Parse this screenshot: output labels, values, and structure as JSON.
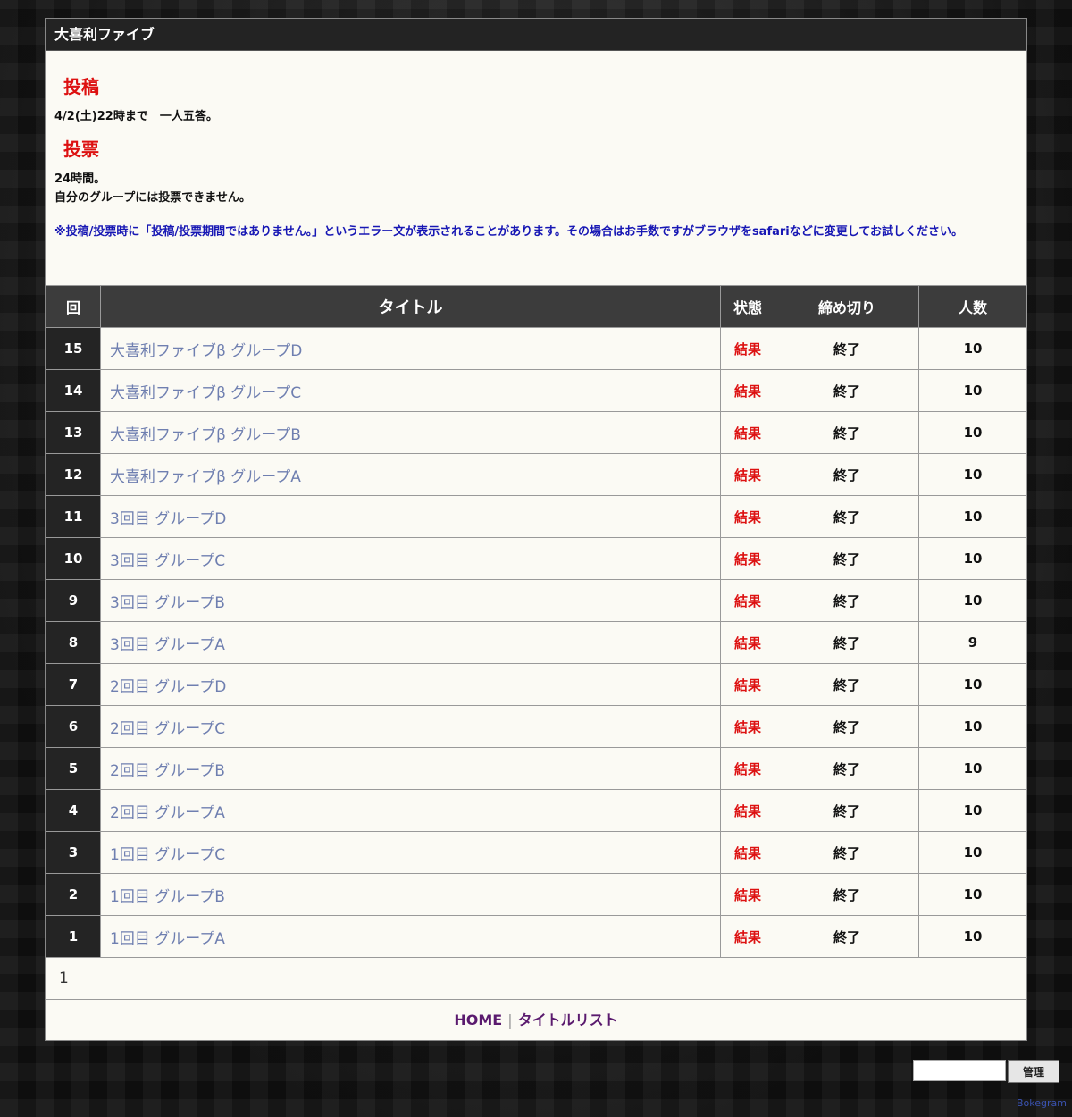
{
  "header": {
    "title": "大喜利ファイブ"
  },
  "info": {
    "post_heading": "投稿",
    "post_text": "4/2(土)22時まで　一人五答。",
    "vote_heading": "投票",
    "vote_line1": "24時間。",
    "vote_line2": "自分のグループには投票できません。",
    "notice": "※投稿/投票時に「投稿/投票期間ではありません。」というエラー文が表示されることがあります。その場合はお手数ですがブラウザをsafariなどに変更してお試しください。"
  },
  "table": {
    "headers": {
      "num": "回",
      "title": "タイトル",
      "status": "状態",
      "deadline": "締め切り",
      "count": "人数"
    },
    "rows": [
      {
        "num": "15",
        "title": "大喜利ファイブβ グループD",
        "status": "結果",
        "deadline": "終了",
        "count": "10"
      },
      {
        "num": "14",
        "title": "大喜利ファイブβ グループC",
        "status": "結果",
        "deadline": "終了",
        "count": "10"
      },
      {
        "num": "13",
        "title": "大喜利ファイブβ グループB",
        "status": "結果",
        "deadline": "終了",
        "count": "10"
      },
      {
        "num": "12",
        "title": "大喜利ファイブβ グループA",
        "status": "結果",
        "deadline": "終了",
        "count": "10"
      },
      {
        "num": "11",
        "title": "3回目 グループD",
        "status": "結果",
        "deadline": "終了",
        "count": "10"
      },
      {
        "num": "10",
        "title": "3回目 グループC",
        "status": "結果",
        "deadline": "終了",
        "count": "10"
      },
      {
        "num": "9",
        "title": "3回目 グループB",
        "status": "結果",
        "deadline": "終了",
        "count": "10"
      },
      {
        "num": "8",
        "title": "3回目 グループA",
        "status": "結果",
        "deadline": "終了",
        "count": "9"
      },
      {
        "num": "7",
        "title": "2回目 グループD",
        "status": "結果",
        "deadline": "終了",
        "count": "10"
      },
      {
        "num": "6",
        "title": "2回目 グループC",
        "status": "結果",
        "deadline": "終了",
        "count": "10"
      },
      {
        "num": "5",
        "title": "2回目 グループB",
        "status": "結果",
        "deadline": "終了",
        "count": "10"
      },
      {
        "num": "4",
        "title": "2回目 グループA",
        "status": "結果",
        "deadline": "終了",
        "count": "10"
      },
      {
        "num": "3",
        "title": "1回目 グループC",
        "status": "結果",
        "deadline": "終了",
        "count": "10"
      },
      {
        "num": "2",
        "title": "1回目 グループB",
        "status": "結果",
        "deadline": "終了",
        "count": "10"
      },
      {
        "num": "1",
        "title": "1回目 グループA",
        "status": "結果",
        "deadline": "終了",
        "count": "10"
      }
    ]
  },
  "pager": {
    "page": "1"
  },
  "footer": {
    "home": "HOME",
    "separator": "|",
    "title_list": "タイトルリスト"
  },
  "admin": {
    "input_value": "",
    "button_label": "管理"
  },
  "credit": "Bokegram"
}
